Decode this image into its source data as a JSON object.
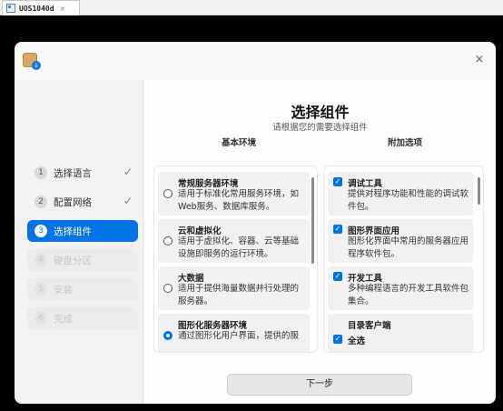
{
  "vm_tab": {
    "label": "UOS1040d",
    "close": "×"
  },
  "window": {
    "close": "×",
    "icon_badge": "↓"
  },
  "sidebar": {
    "steps": [
      {
        "num": "1",
        "label": "选择语言",
        "state": "done"
      },
      {
        "num": "2",
        "label": "配置网络",
        "state": "done"
      },
      {
        "num": "3",
        "label": "选择组件",
        "state": "active"
      },
      {
        "num": "4",
        "label": "硬盘分区",
        "state": "disabled"
      },
      {
        "num": "5",
        "label": "安装",
        "state": "disabled"
      },
      {
        "num": "6",
        "label": "完成",
        "state": "disabled"
      }
    ],
    "check": "✓"
  },
  "main": {
    "title": "选择组件",
    "subtitle": "请根据您的需要选择组件",
    "left_header": "基本环境",
    "right_header": "附加选项",
    "base_env": [
      {
        "title": "常规服务器环境",
        "desc": "适用于标准化常用服务环境，如\nWeb服务、数据库服务。",
        "selected": false
      },
      {
        "title": "云和虚拟化",
        "desc": "适用于虚拟化、容器、云等基础\n设施即服务的运行环境。",
        "selected": false
      },
      {
        "title": "大数据",
        "desc": "适用于提供海量数据并行处理的\n服务器。",
        "selected": false
      },
      {
        "title": "图形化服务器环境",
        "desc": "通过图形化用户界面，提供的服",
        "selected": true
      }
    ],
    "addons": [
      {
        "title": "调试工具",
        "desc": "提供对程序功能和性能的调试软\n件包。",
        "checked": true
      },
      {
        "title": "图形界面应用",
        "desc": "图形化界面中常用的服务器应用\n程序软件包。",
        "checked": true
      },
      {
        "title": "开发工具",
        "desc": "多种编程语言的开发工具软件包\n集合。",
        "checked": true
      },
      {
        "title": "目录客户端",
        "desc": "",
        "checked": false
      }
    ],
    "select_all": "全选",
    "check_glyph": "✓",
    "next_button": "下一步"
  },
  "colors": {
    "accent": "#0073e6",
    "window_bg": "#f8f8f8"
  }
}
